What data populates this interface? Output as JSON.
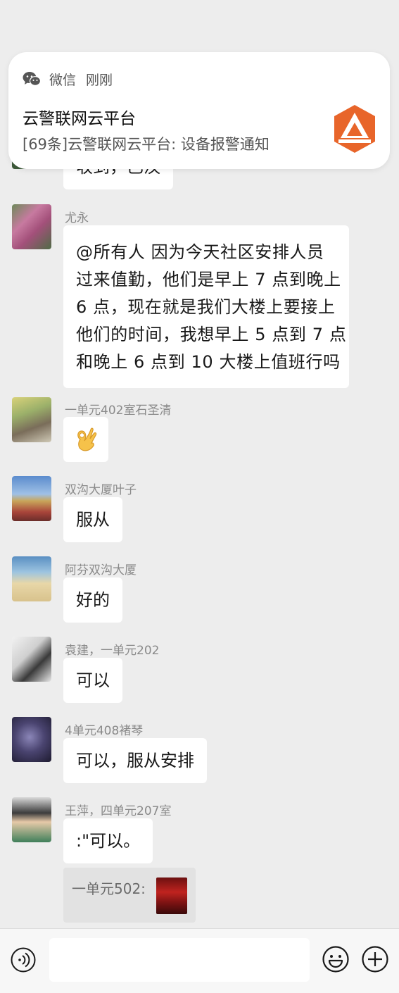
{
  "notification": {
    "app_name": "微信",
    "time": "刚刚",
    "title": "云警联网云平台",
    "body": "[69条]云警联网云平台: 设备报警通知"
  },
  "messages": [
    {
      "text": "收到，已汉"
    },
    {
      "sender": "尤永",
      "text": "@所有人  因为今天社区安排人员\n过来值勤，他们是早上 7 点到晚上\n6 点，现在就是我们大楼上要接上\n他们的时间，我想早上 5 点到 7 点\n和晚上 6 点到 10 大楼上值班行吗"
    },
    {
      "sender": "一单元402室石圣清",
      "emoji": "ok-hand-emoji"
    },
    {
      "sender": "双沟大厦叶子",
      "text": "服从"
    },
    {
      "sender": "阿芬双沟大厦",
      "text": "好的"
    },
    {
      "sender": "袁建，一单元202",
      "text": "可以"
    },
    {
      "sender": "4单元408褚琴",
      "text": "可以，服从安排"
    },
    {
      "sender": "王萍，四单元207室",
      "text": ":\"可以。",
      "quote": {
        "label": "一单元502:"
      }
    }
  ],
  "input_bar": {
    "placeholder": "",
    "icons": [
      "voice-icon",
      "emoji-face-icon",
      "plus-icon"
    ]
  }
}
